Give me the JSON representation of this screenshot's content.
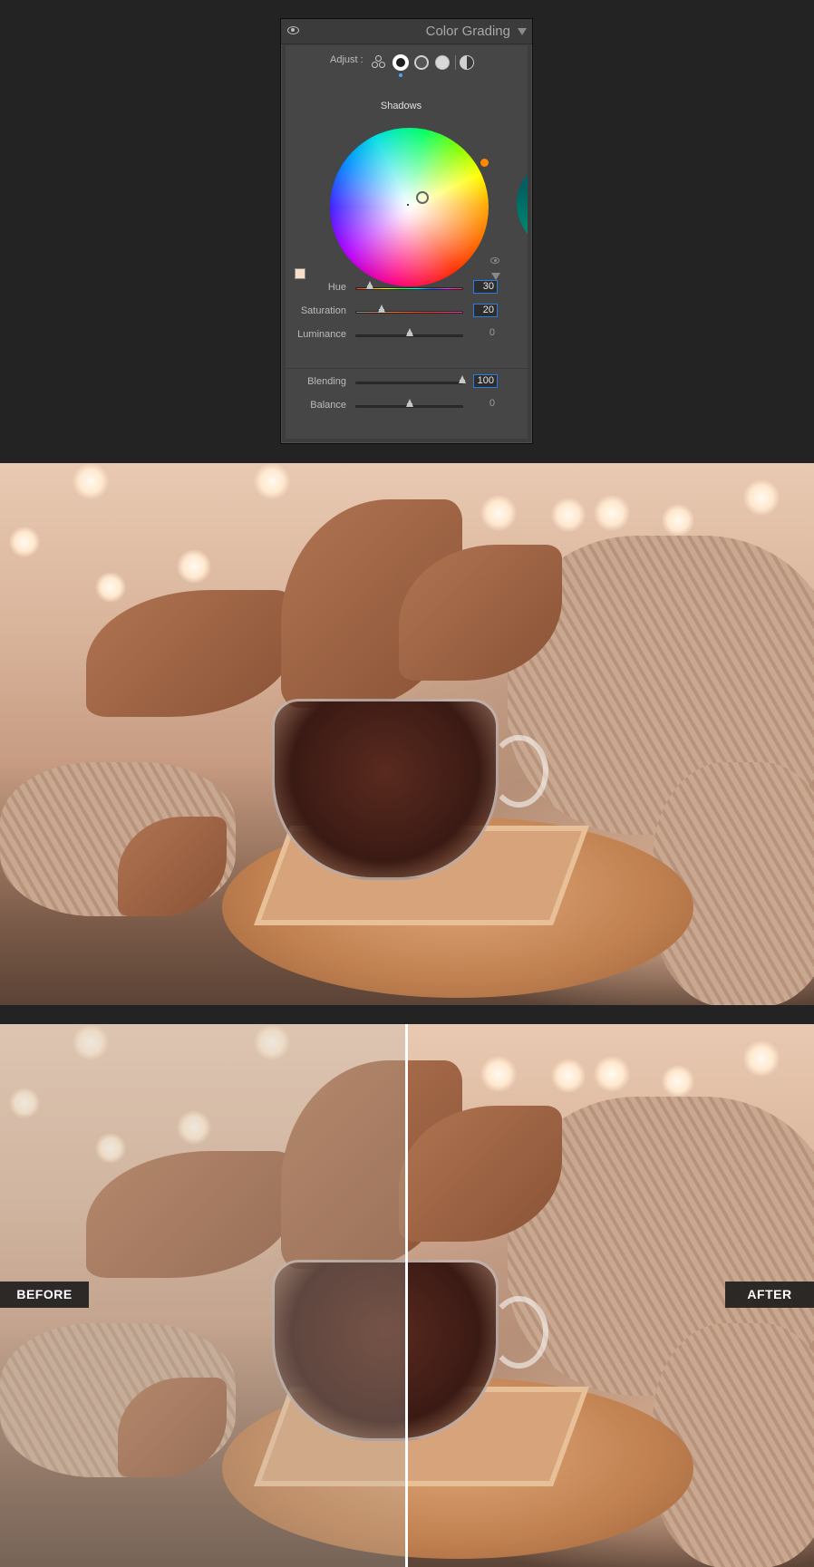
{
  "panel": {
    "title": "Color Grading",
    "adjust_label": "Adjust :",
    "modes": [
      "3-way",
      "shadows",
      "midtones",
      "highlights",
      "global"
    ],
    "selected_mode": "shadows",
    "wheel_label": "Shadows",
    "swatch_color": "#f9dfc8",
    "hue_marker_color": "#ff8a00",
    "sliders": [
      {
        "label": "Hue",
        "value": "30",
        "active": true
      },
      {
        "label": "Saturation",
        "value": "20",
        "active": true
      },
      {
        "label": "Luminance",
        "value": "0",
        "active": false
      }
    ],
    "sliders2": [
      {
        "label": "Blending",
        "value": "100",
        "active": true
      },
      {
        "label": "Balance",
        "value": "0",
        "active": false
      }
    ]
  },
  "compare": {
    "before_label": "BEFORE",
    "after_label": "AFTER"
  }
}
